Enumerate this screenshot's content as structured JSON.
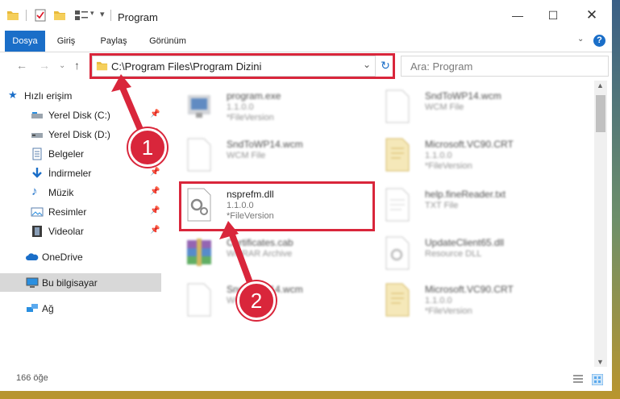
{
  "window": {
    "title": "Program"
  },
  "ribbon": {
    "tabs": [
      "Dosya",
      "Giriş",
      "Paylaş",
      "Görünüm"
    ],
    "help_label": "?"
  },
  "address": {
    "path": "C:\\Program Files\\Program Dizini"
  },
  "search": {
    "placeholder": "Ara: Program"
  },
  "sidebar": {
    "quick_access": "Hızlı erişim",
    "items": [
      "Yerel Disk (C:)",
      "Yerel Disk (D:)",
      "Belgeler",
      "İndirmeler",
      "Müzik",
      "Resimler",
      "Videolar"
    ],
    "onedrive": "OneDrive",
    "this_pc": "Bu bilgisayar",
    "network": "Ağ"
  },
  "files": [
    {
      "name": "program.exe",
      "type": "1.1.0.0",
      "version": "*FileVersion"
    },
    {
      "name": "SndToWP14.wcm",
      "type": "WCM File",
      "version": ""
    },
    {
      "name": "SndToWP14.wcm",
      "type": "WCM File",
      "version": ""
    },
    {
      "name": "Microsoft.VC90.CRT",
      "type": "1.1.0.0",
      "version": "*FileVersion"
    },
    {
      "name": "nsprefm.dll",
      "type": "1.1.0.0",
      "version": "*FileVersion"
    },
    {
      "name": "help.fineReader.txt",
      "type": "TXT File",
      "version": ""
    },
    {
      "name": "Certificates.cab",
      "type": "WinRAR Archive",
      "version": ""
    },
    {
      "name": "UpdateClient65.dll",
      "type": "Resource DLL",
      "version": ""
    },
    {
      "name": "SndToWP14.wcm",
      "type": "WCM File",
      "version": ""
    },
    {
      "name": "Microsoft.VC90.CRT",
      "type": "1.1.0.0",
      "version": "*FileVersion"
    }
  ],
  "status": {
    "count": "166 öğe"
  },
  "annotations": {
    "step1": "1",
    "step2": "2"
  },
  "colors": {
    "accent": "#1a6ec8",
    "highlight": "#d9263b"
  }
}
